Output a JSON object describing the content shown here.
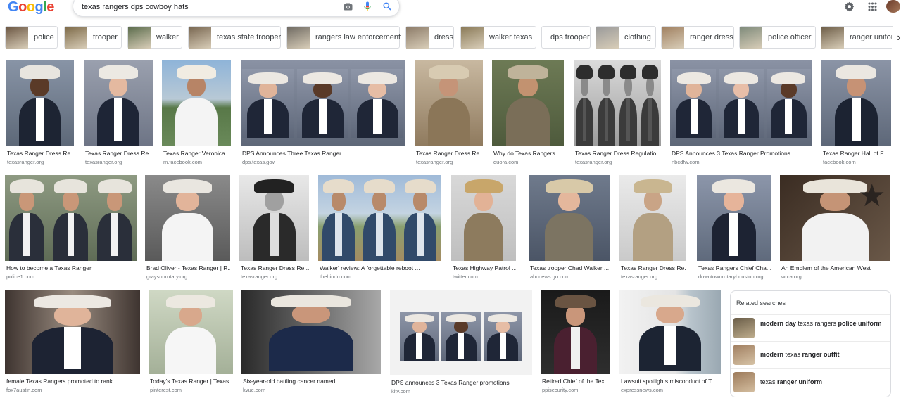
{
  "header": {
    "logo_letters": [
      "G",
      "o",
      "o",
      "g",
      "l",
      "e"
    ],
    "logo_colors": [
      "#4285f4",
      "#ea4335",
      "#fbbc05",
      "#4285f4",
      "#34a853",
      "#ea4335"
    ],
    "query": "texas rangers dps cowboy hats",
    "icons": [
      "camera-icon",
      "microphone-icon",
      "search-icon",
      "gear-icon",
      "apps-icon",
      "avatar"
    ]
  },
  "chips": [
    {
      "label": "police",
      "has_thumb": true
    },
    {
      "label": "trooper",
      "has_thumb": true
    },
    {
      "label": "walker",
      "has_thumb": true
    },
    {
      "label": "texas state trooper",
      "has_thumb": true
    },
    {
      "label": "rangers law enforcement",
      "has_thumb": true
    },
    {
      "label": "dress",
      "has_thumb": true
    },
    {
      "label": "walker texas",
      "has_thumb": true
    },
    {
      "label": "dps trooper",
      "has_thumb": false
    },
    {
      "label": "clothing",
      "has_thumb": true
    },
    {
      "label": "ranger dress",
      "has_thumb": true
    },
    {
      "label": "police officer",
      "has_thumb": true
    },
    {
      "label": "ranger uniform",
      "has_thumb": true
    }
  ],
  "results": [
    {
      "title": "Texas Ranger Dress Re...",
      "source": "texasranger.org"
    },
    {
      "title": "Texas Ranger Dress Re...",
      "source": "texasranger.org"
    },
    {
      "title": "Texas Ranger Veronica...",
      "source": "m.facebook.com"
    },
    {
      "title": "DPS Announces Three Texas Ranger ...",
      "source": "dps.texas.gov"
    },
    {
      "title": "Texas Ranger Dress Re...",
      "source": "texasranger.org"
    },
    {
      "title": "Why do Texas Rangers ...",
      "source": "quora.com"
    },
    {
      "title": "Texas Ranger Dress Regulatio...",
      "source": "texasranger.org"
    },
    {
      "title": "DPS Announces 3 Texas Ranger Promotions ...",
      "source": "nbcdfw.com"
    },
    {
      "title": "Texas Ranger Hall of F...",
      "source": "facebook.com"
    },
    {
      "title": "How to become a Texas Ranger",
      "source": "police1.com"
    },
    {
      "title": "Brad Oliver - Texas Ranger | R...",
      "source": "graysonrotary.org"
    },
    {
      "title": "Texas Ranger Dress Re...",
      "source": "texasranger.org"
    },
    {
      "title": "Walker' review: A forgettable reboot ...",
      "source": "thehindu.com"
    },
    {
      "title": "Texas Highway Patrol ...",
      "source": "twitter.com"
    },
    {
      "title": "Texas trooper Chad Walker ...",
      "source": "abcnews.go.com"
    },
    {
      "title": "Texas Ranger Dress Re...",
      "source": "texasranger.org"
    },
    {
      "title": "Texas Rangers Chief Cha...",
      "source": "downtownrotaryhouston.org"
    },
    {
      "title": "An Emblem of the American West",
      "source": "wrca.org"
    },
    {
      "title": "female Texas Rangers promoted to rank ...",
      "source": "fox7austin.com"
    },
    {
      "title": "Today's Texas Ranger | Texas ...",
      "source": "pinterest.com"
    },
    {
      "title": "Six-year-old battling cancer named ...",
      "source": "kvue.com"
    },
    {
      "title": "DPS announces 3 Texas Ranger promotions",
      "source": "kltv.com"
    },
    {
      "title": "Retired Chief of the Tex...",
      "source": "ppisecurity.com"
    },
    {
      "title": "Lawsuit spotlights misconduct of T...",
      "source": "expressnews.com"
    }
  ],
  "related": {
    "title": "Related searches",
    "items": [
      {
        "parts": [
          {
            "t": "modern day",
            "b": true
          },
          {
            "t": " texas rangers ",
            "b": false
          },
          {
            "t": "police uniform",
            "b": true
          }
        ]
      },
      {
        "parts": [
          {
            "t": "modern",
            "b": true
          },
          {
            "t": " texas ",
            "b": false
          },
          {
            "t": "ranger outfit",
            "b": true
          }
        ]
      },
      {
        "parts": [
          {
            "t": "texas ",
            "b": false
          },
          {
            "t": "ranger uniform",
            "b": true
          }
        ]
      }
    ]
  }
}
